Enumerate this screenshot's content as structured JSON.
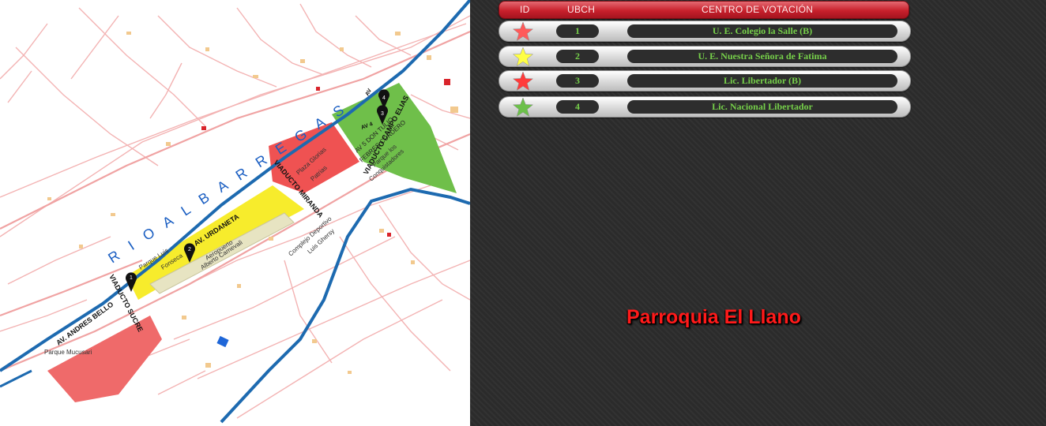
{
  "table": {
    "header": {
      "id": "ID",
      "ubch": "UBCH",
      "centro": "CENTRO DE VOTACIÓN"
    },
    "rows": [
      {
        "id": "1",
        "name": "U. E. Colegio la Salle (B)",
        "star_color": "#ff5a5a"
      },
      {
        "id": "2",
        "name": "U. E. Nuestra Señora de Fatima",
        "star_color": "#ffff44"
      },
      {
        "id": "3",
        "name": "Lic. Libertador (B)",
        "star_color": "#ff3b3b"
      },
      {
        "id": "4",
        "name": "Lic. Nacional Libertador",
        "star_color": "#6cc04a"
      }
    ]
  },
  "title": "Parroquia El Llano",
  "map": {
    "river_label": "R I O   A L B A R R E G A S",
    "labels": {
      "viaducto_campo_elias": "VIADUCTO CAMPO ELIAS",
      "viaducto_miranda": "VIADUCTO MIRANDA",
      "av_urdaneta": "AV. URDANETA",
      "viaducto_sucre": "VIADUCTO SUCRE",
      "av_andres_bello": "AV. ANDRES BELLO",
      "av_5_line1": "AV 5 DON TULIO",
      "av_5_line2": "FEBRES CORDERO",
      "parque_conq_1": "Parque los",
      "parque_conq_2": "Conquistadores",
      "plaza_glorias_1": "Plaza Glorias",
      "plaza_glorias_2": "Patrias",
      "complejo_1": "Complejo Deportivo",
      "complejo_2": "Luis Ghersy",
      "aeropuerto_1": "Aeropuerto",
      "aeropuerto_2": "Alberto Carnevali",
      "parque_luis_1": "Parque Luis",
      "parque_luis_2": "Fonseca",
      "parque_mucusari": "Parque Mucusari",
      "av_short_a": "AV",
      "av_short_b": "AV 4"
    },
    "markers": [
      "1",
      "2",
      "3",
      "4"
    ]
  }
}
